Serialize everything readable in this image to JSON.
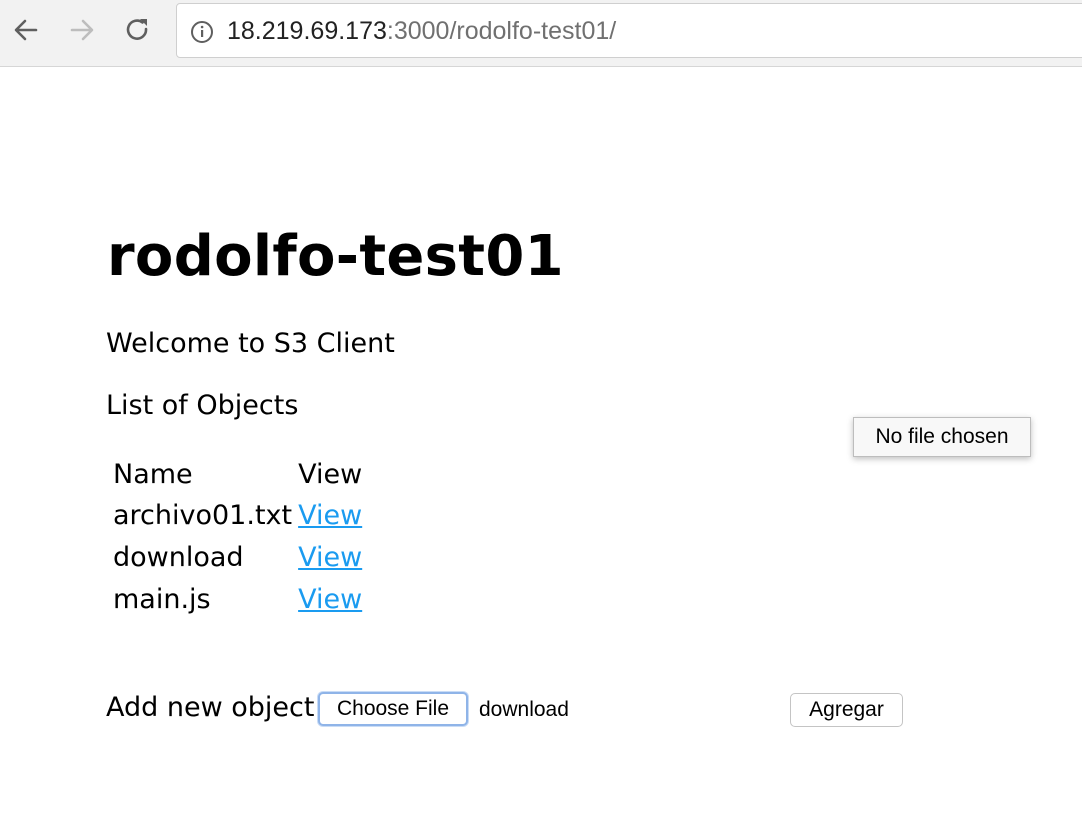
{
  "browser": {
    "url_host": "18.219.69.173",
    "url_rest": ":3000/rodolfo-test01/"
  },
  "page": {
    "title": "rodolfo-test01",
    "welcome": "Welcome to S3 Client",
    "list_heading": "List of Objects",
    "table": {
      "columns": [
        "Name",
        "View"
      ],
      "rows": [
        {
          "name": "archivo01.txt",
          "link": "View"
        },
        {
          "name": "download",
          "link": "View"
        },
        {
          "name": "main.js",
          "link": "View"
        }
      ]
    },
    "add_form": {
      "label": "Add new object",
      "choose_file_label": "Choose File",
      "selected_file": "download",
      "submit_label": "Agregar"
    },
    "tooltip": "No file chosen"
  },
  "colors": {
    "link": "#1a9bf0",
    "toolbar_bg": "#f2f2f2"
  }
}
